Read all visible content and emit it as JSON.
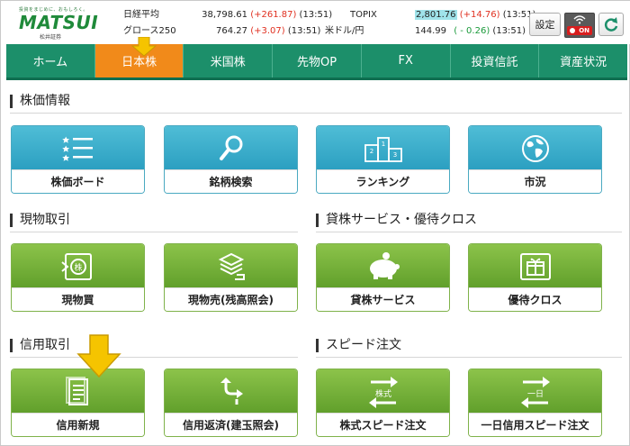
{
  "header": {
    "logo": {
      "tagline": "投資をまじめに、おもしろく。",
      "name": "MATSUI",
      "sub": "松井証券"
    },
    "tickers": [
      {
        "label": "日経平均",
        "value": "38,798.61",
        "change": "(+261.87)",
        "dir": "up",
        "time": "(13:51)"
      },
      {
        "label": "TOPIX",
        "value": "2,801.76",
        "change": "(+14.76)",
        "dir": "up",
        "time": "(13:51)"
      },
      {
        "label": "グロース250",
        "value": "764.27",
        "change": "(+3.07)",
        "dir": "up",
        "time": "(13:51)"
      },
      {
        "label": "米ドル/円",
        "value": "144.99",
        "change": "( - 0.26)",
        "dir": "down",
        "time": "(13:51)"
      }
    ],
    "settings_label": "設定",
    "on_label": "ON"
  },
  "nav": {
    "items": [
      {
        "label": "ホーム"
      },
      {
        "label": "日本株",
        "active": true
      },
      {
        "label": "米国株"
      },
      {
        "label": "先物OP"
      },
      {
        "label": "FX"
      },
      {
        "label": "投資信託"
      },
      {
        "label": "資産状況"
      }
    ]
  },
  "sections": {
    "kabuka": {
      "title": "株価情報",
      "tiles": [
        {
          "label": "株価ボード",
          "icon": "list-icon"
        },
        {
          "label": "銘柄検索",
          "icon": "search-icon"
        },
        {
          "label": "ランキング",
          "icon": "podium-icon"
        },
        {
          "label": "市況",
          "icon": "globe-icon"
        }
      ]
    },
    "genbutsu": {
      "title": "現物取引",
      "tiles": [
        {
          "label": "現物買",
          "icon": "buy-stock-icon",
          "icon_text": "株"
        },
        {
          "label": "現物売(残高照会)",
          "icon": "sell-stack-icon"
        }
      ]
    },
    "kashikabu": {
      "title": "貸株サービス・優待クロス",
      "tiles": [
        {
          "label": "貸株サービス",
          "icon": "piggy-bank-icon"
        },
        {
          "label": "優待クロス",
          "icon": "gift-icon"
        }
      ]
    },
    "shinyo": {
      "title": "信用取引",
      "tiles": [
        {
          "label": "信用新規",
          "icon": "document-icon"
        },
        {
          "label": "信用返済(建玉照会)",
          "icon": "return-icon"
        }
      ]
    },
    "speed": {
      "title": "スピード注文",
      "tiles": [
        {
          "label": "株式スピード注文",
          "icon": "exchange-icon",
          "icon_text": "株式"
        },
        {
          "label": "一日信用スピード注文",
          "icon": "exchange-icon",
          "icon_text": "一日"
        }
      ]
    }
  },
  "colors": {
    "nav": "#1c8f6a",
    "nav_active": "#f18a1a",
    "tile_blue": "#2a9ec0",
    "tile_green": "#5f9e2a",
    "up": "#e03020",
    "down": "#1a9a3a",
    "highlight_arrow": "#f5c400"
  }
}
